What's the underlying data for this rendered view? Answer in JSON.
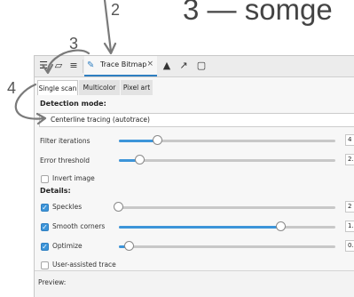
{
  "annotations": {
    "n2": "2",
    "n3": "3",
    "n4": "4",
    "heading_fragment": "3 — somge"
  },
  "toolbar": {
    "icons": [
      "fill-stroke-icon",
      "transform-icon",
      "align-icon",
      "objects-icon",
      "export-icon",
      "document-icon"
    ],
    "tab_label": "Trace Bitmap",
    "tab_close": "×"
  },
  "modes": {
    "single": "Single scan",
    "multi": "Multicolor",
    "pixel": "Pixel art"
  },
  "detection": {
    "heading": "Detection mode:",
    "selected": "Centerline tracing (autotrace)"
  },
  "params": {
    "filter_label": "Filter iterations",
    "filter_value": "4",
    "filter_level": 0.18,
    "error_label": "Error threshold",
    "error_value": "2.",
    "error_level": 0.1
  },
  "invert": {
    "label": "Invert image",
    "checked": false
  },
  "details": {
    "heading": "Details:",
    "speckles_label": "Speckles",
    "speckles_value": "2",
    "speckles_level": 0.0,
    "corners_label": "Smooth corners",
    "corners_value": "1.",
    "corners_level": 0.75,
    "optimize_label": "Optimize",
    "optimize_value": "0.",
    "optimize_level": 0.05
  },
  "assisted": {
    "label": "User-assisted trace",
    "checked": false
  },
  "preview": {
    "label": "Preview:"
  }
}
